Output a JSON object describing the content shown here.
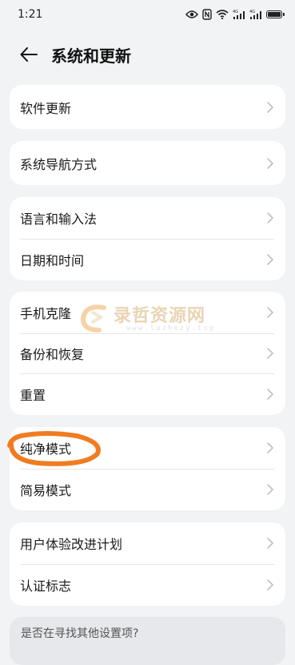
{
  "status_bar": {
    "time": "1:21",
    "icons": [
      "eye-icon",
      "nfc-icon",
      "wifi-icon",
      "signal-4g-icon",
      "signal-4g-icon",
      "battery-icon"
    ],
    "network_label_1": "4G",
    "network_label_2": "4G"
  },
  "header": {
    "title": "系统和更新",
    "back_icon": "arrow-left-icon"
  },
  "groups": [
    {
      "items": [
        {
          "label": "软件更新"
        }
      ]
    },
    {
      "items": [
        {
          "label": "系统导航方式"
        }
      ]
    },
    {
      "items": [
        {
          "label": "语言和输入法"
        },
        {
          "label": "日期和时间"
        }
      ]
    },
    {
      "items": [
        {
          "label": "手机克隆"
        },
        {
          "label": "备份和恢复"
        },
        {
          "label": "重置"
        }
      ]
    },
    {
      "items": [
        {
          "label": "纯净模式"
        },
        {
          "label": "简易模式"
        }
      ]
    },
    {
      "items": [
        {
          "label": "用户体验改进计划"
        },
        {
          "label": "认证标志"
        }
      ]
    }
  ],
  "footer": {
    "prompt": "是否在寻找其他设置项?"
  },
  "watermark": {
    "title": "录哲资源网",
    "url": "www.luzhezy.top"
  },
  "annotation": {
    "color": "#f07c22"
  }
}
